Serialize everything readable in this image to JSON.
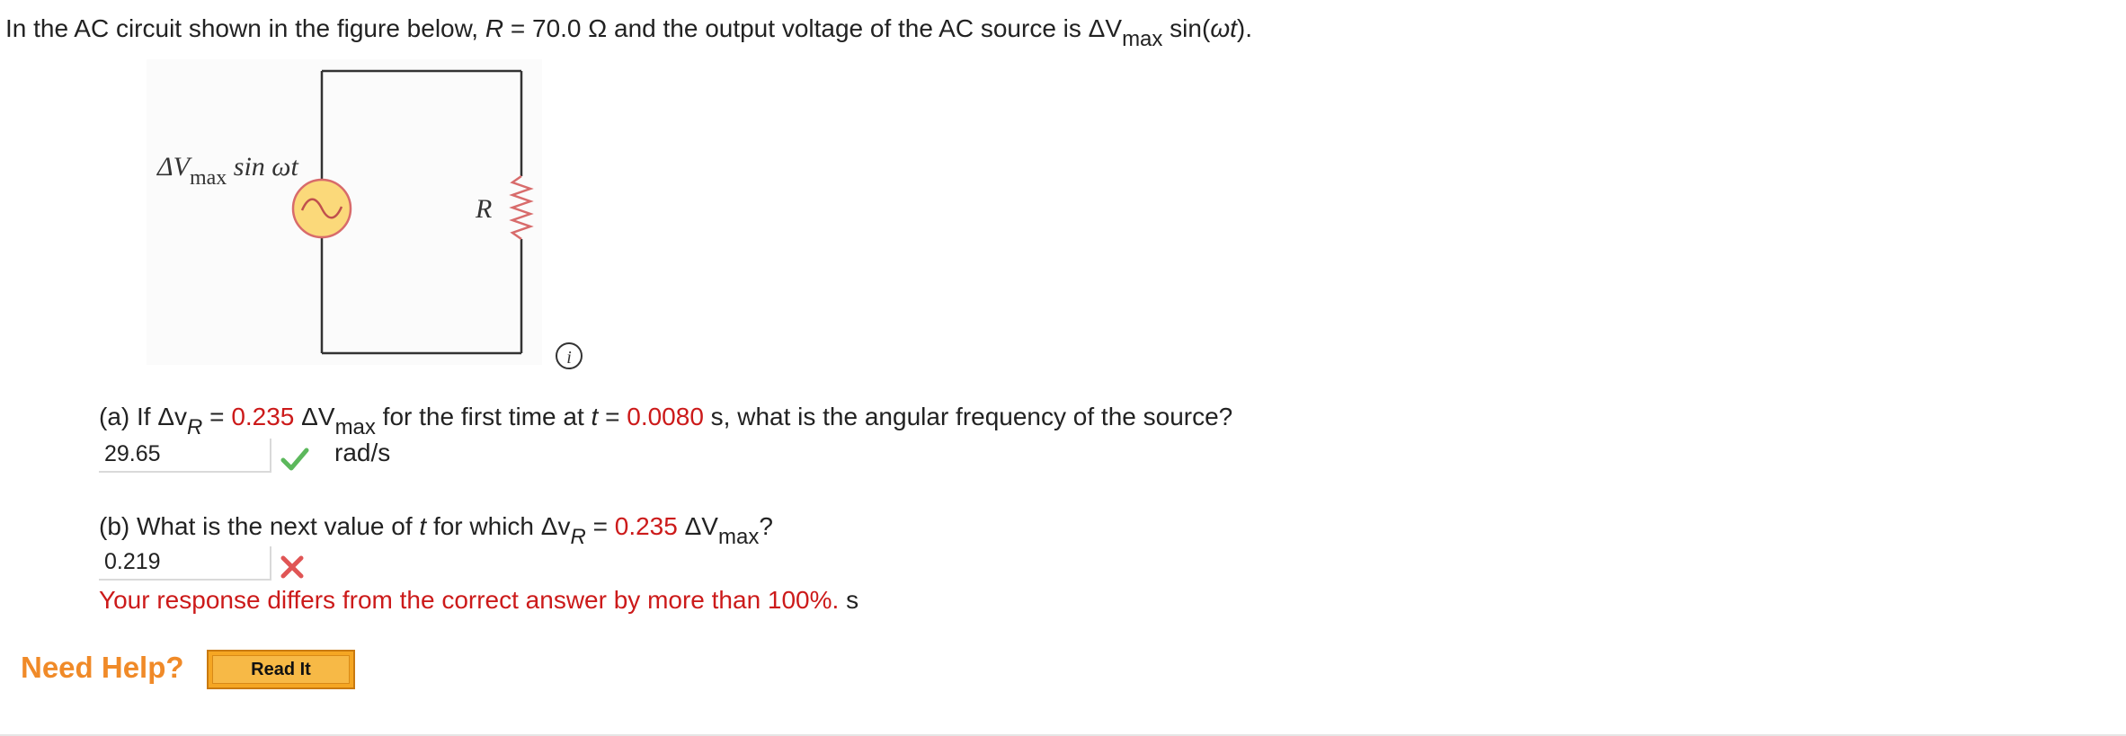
{
  "intro": {
    "p1": "In the AC circuit shown in the figure below, ",
    "R_sym": "R",
    "p2": " = 70.0 Ω and the output voltage of the AC source is ΔV",
    "sub_max": "max",
    "p3": " sin(",
    "omega_t": "ωt",
    "p4": ")."
  },
  "figure": {
    "source_label_main": "ΔV",
    "source_label_sub": "max",
    "source_label_tail": " sin ωt",
    "resistor_label": "R",
    "info_icon_glyph": "i",
    "source_fill": "#fbd97a",
    "source_stroke": "#d86b6b",
    "wire_color": "#333333"
  },
  "part_a": {
    "q1": "(a) If Δv",
    "sub_R": "R",
    "q2": " = ",
    "value1": "0.235",
    "q3": " ΔV",
    "sub_max": "max",
    "q4": " for the first time at ",
    "t_sym": "t",
    "q5": " = ",
    "value2": "0.0080",
    "q6": " s, what is the angular frequency of the source?",
    "answer": "29.65",
    "unit": "rad/s",
    "status": "correct"
  },
  "part_b": {
    "q1": "(b) What is the next value of ",
    "t_sym": "t",
    "q2": " for which Δv",
    "sub_R": "R",
    "q3": " = ",
    "value1": "0.235",
    "q4": " ΔV",
    "sub_max": "max",
    "q5": "?",
    "answer": "0.219",
    "status": "incorrect",
    "feedback": "Your response differs from the correct answer by more than 100%.",
    "unit": "s"
  },
  "help": {
    "need_help": "Need Help?",
    "read_it": "Read It"
  },
  "colors": {
    "accent_red": "#cc1a1a",
    "check_green": "#5cb85c",
    "cross_red": "#e05555",
    "help_orange": "#f08a28"
  }
}
